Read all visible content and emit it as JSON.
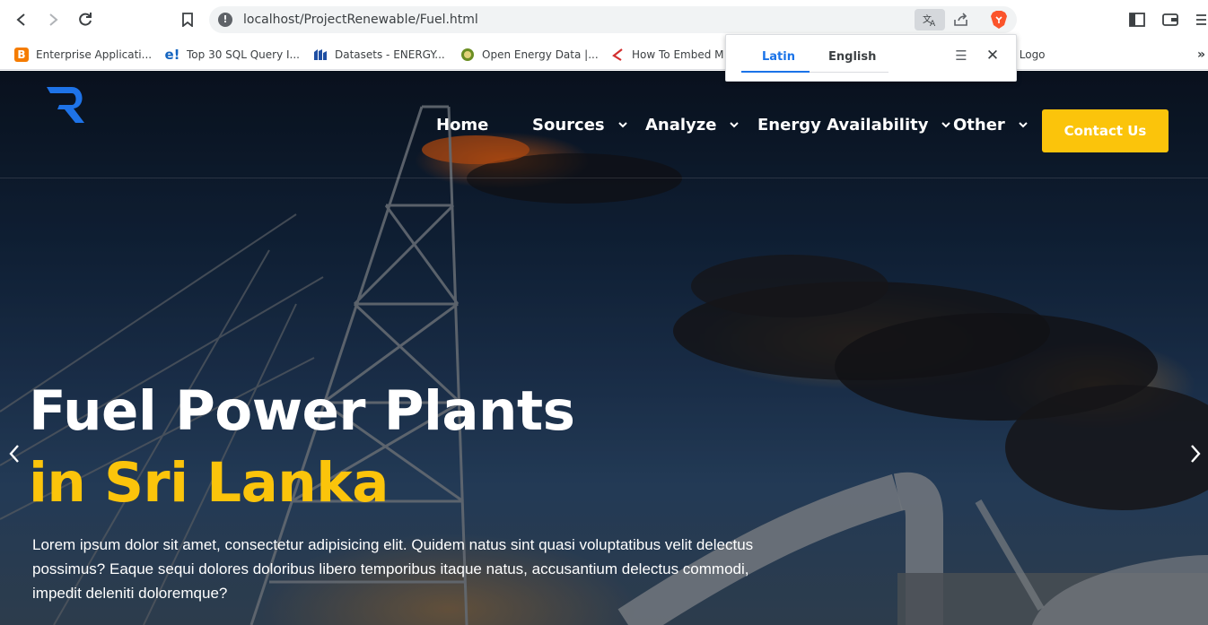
{
  "browser": {
    "url": "localhost/ProjectRenewable/Fuel.html",
    "bookmarks": [
      {
        "label": "Enterprise Applicati...",
        "icon": "blogger-icon",
        "color": "#f57c00"
      },
      {
        "label": "Top 30 SQL Query I...",
        "icon": "edureka-icon",
        "color": "#1565c0"
      },
      {
        "label": "Datasets - ENERGY...",
        "icon": "energy-data-icon",
        "color": "#1f4fa3"
      },
      {
        "label": "Open Energy Data |...",
        "icon": "doe-seal-icon",
        "color": "#6b8e23"
      },
      {
        "label": "How To Embed M",
        "icon": "how-to-icon",
        "color": "#d32f2f"
      },
      {
        "label": "r Logo",
        "icon": "",
        "color": ""
      }
    ],
    "more_bookmarks": "»"
  },
  "translate_popup": {
    "source_lang": "Latin",
    "target_lang": "English"
  },
  "site": {
    "nav": [
      {
        "label": "Home",
        "has_dropdown": false
      },
      {
        "label": "Sources",
        "has_dropdown": true
      },
      {
        "label": "Analyze",
        "has_dropdown": true
      },
      {
        "label": "Energy Availability",
        "has_dropdown": true
      },
      {
        "label": "Other",
        "has_dropdown": true
      }
    ],
    "contact_label": "Contact Us",
    "accent_color": "#fbc40b",
    "logo_color": "#1e73e8"
  },
  "hero": {
    "title_line1": "Fuel Power Plants",
    "title_line2": "in Sri Lanka",
    "description": "Lorem ipsum dolor sit amet, consectetur adipisicing elit. Quidem natus sint quasi voluptatibus velit delectus possimus? Eaque sequi dolores doloribus libero temporibus itaque natus, accusantium delectus commodi, impedit deleniti doloremque?"
  }
}
